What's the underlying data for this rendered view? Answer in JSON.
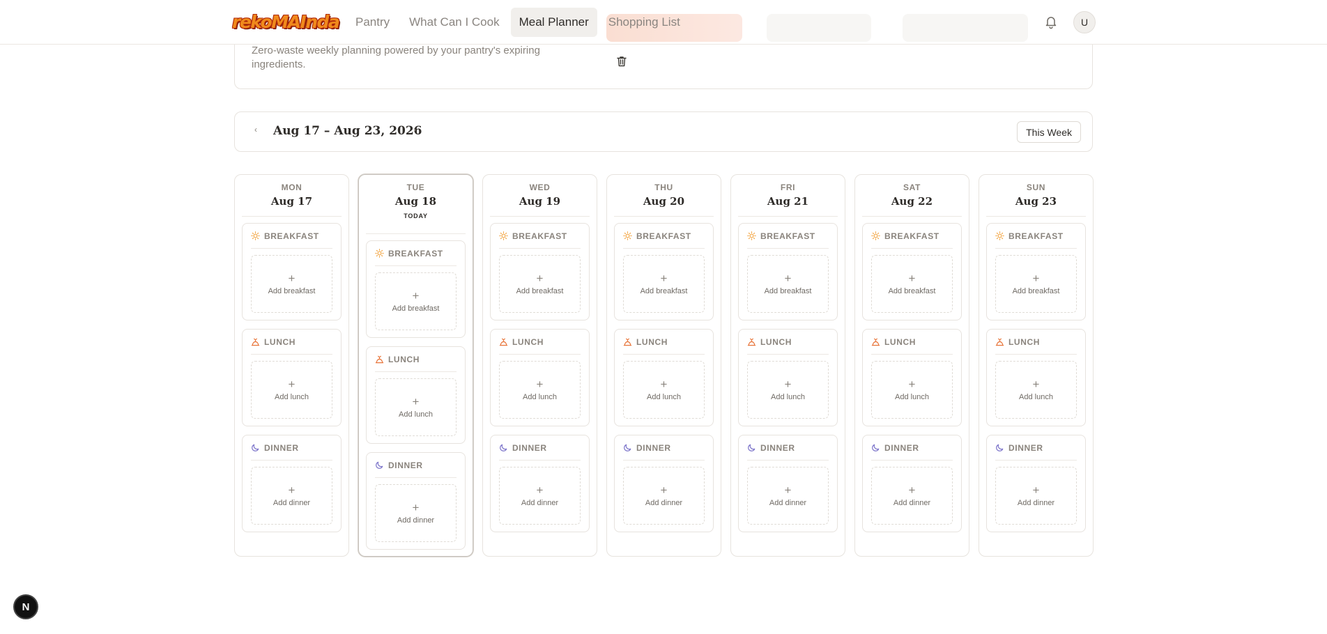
{
  "app": {
    "logo_text": "rekoMAInda"
  },
  "nav": {
    "items": [
      {
        "label": "Pantry",
        "active": false
      },
      {
        "label": "What Can I Cook",
        "active": false
      },
      {
        "label": "Meal Planner",
        "active": true
      },
      {
        "label": "Shopping List",
        "active": false
      }
    ],
    "avatar_initial": "U"
  },
  "header": {
    "subtitle": "Zero-waste weekly planning powered by your pantry's expiring ingredients."
  },
  "week": {
    "range": "Aug 17 – Aug 23, 2026",
    "prev_icon": "‹",
    "next_icon": "›",
    "this_week_label": "This Week"
  },
  "meals": {
    "breakfast": {
      "label": "BREAKFAST",
      "add": "Add breakfast",
      "icon": "sun-icon",
      "color": "#f2a23c"
    },
    "lunch": {
      "label": "LUNCH",
      "add": "Add lunch",
      "icon": "lunch-icon",
      "color": "#e8753a"
    },
    "dinner": {
      "label": "DINNER",
      "add": "Add dinner",
      "icon": "moon-icon",
      "color": "#7a72c9"
    }
  },
  "days": [
    {
      "dow": "MON",
      "date": "Aug 17",
      "today": false,
      "today_label": ""
    },
    {
      "dow": "TUE",
      "date": "Aug 18",
      "today": true,
      "today_label": "TODAY"
    },
    {
      "dow": "WED",
      "date": "Aug 19",
      "today": false,
      "today_label": ""
    },
    {
      "dow": "THU",
      "date": "Aug 20",
      "today": false,
      "today_label": ""
    },
    {
      "dow": "FRI",
      "date": "Aug 21",
      "today": false,
      "today_label": ""
    },
    {
      "dow": "SAT",
      "date": "Aug 22",
      "today": false,
      "today_label": ""
    },
    {
      "dow": "SUN",
      "date": "Aug 23",
      "today": false,
      "today_label": ""
    }
  ],
  "dev_badge": "N"
}
